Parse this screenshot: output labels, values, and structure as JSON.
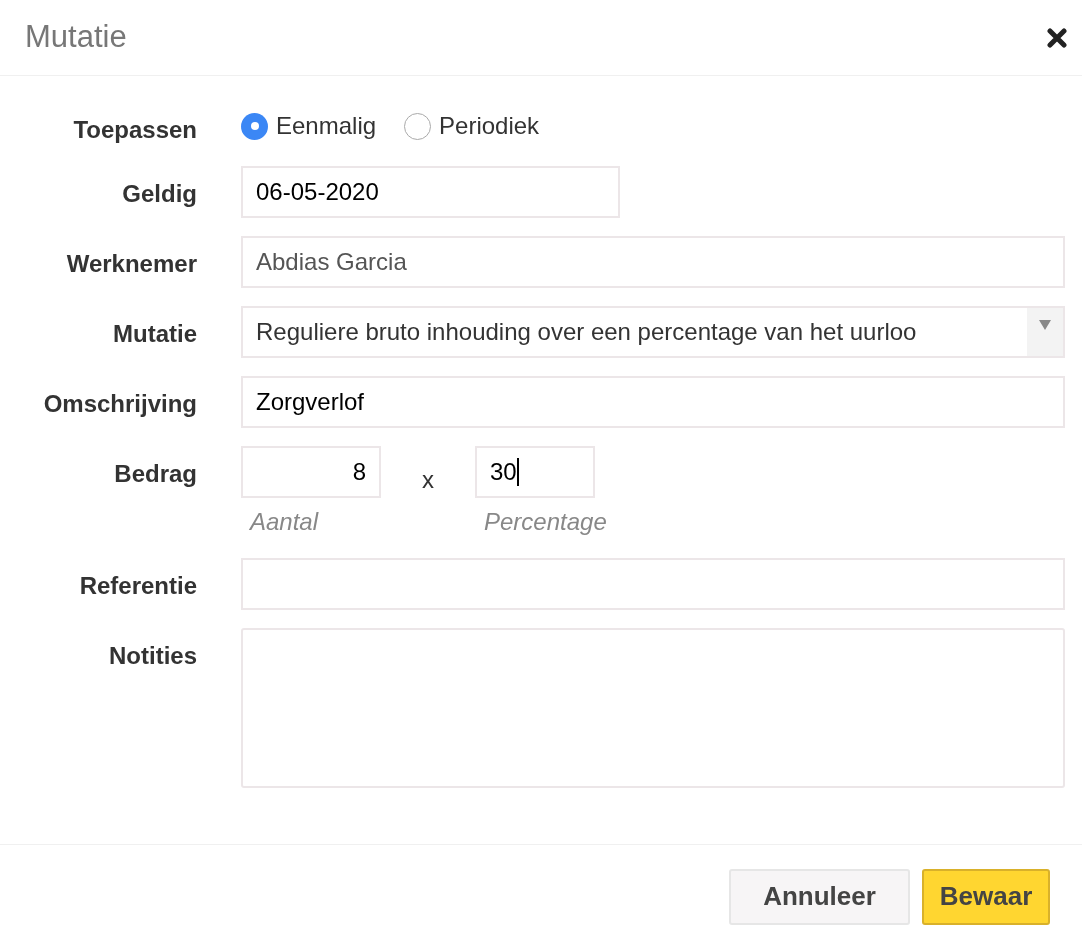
{
  "dialog": {
    "title": "Mutatie"
  },
  "fields": [
    {
      "kind": "radio",
      "label": "Toepassen",
      "options": [
        {
          "label": "Eenmalig",
          "selected": true
        },
        {
          "label": "Periodiek",
          "selected": false
        }
      ]
    },
    {
      "kind": "date",
      "label": "Geldig",
      "value": "06-05-2020",
      "disabled": false
    },
    {
      "kind": "text",
      "label": "Werknemer",
      "value": "Abdias Garcia",
      "disabled": true
    },
    {
      "kind": "select",
      "label": "Mutatie",
      "value": "Reguliere bruto inhouding over een percentage van het uurloo"
    },
    {
      "kind": "text",
      "label": "Omschrijving",
      "value": "Zorgverlof",
      "disabled": false
    },
    {
      "kind": "amount",
      "label": "Bedrag",
      "operator": "x",
      "inputs": [
        {
          "value": "8",
          "caption": "Aantal"
        },
        {
          "value": "30",
          "caption": "Percentage",
          "focused": true
        }
      ]
    },
    {
      "kind": "text",
      "label": "Referentie"
    },
    {
      "kind": "textarea",
      "label": "Notities"
    }
  ],
  "buttons": [
    {
      "label": "Annuleer",
      "kind": "secondary"
    },
    {
      "label": "Bewaar",
      "kind": "primary"
    }
  ]
}
